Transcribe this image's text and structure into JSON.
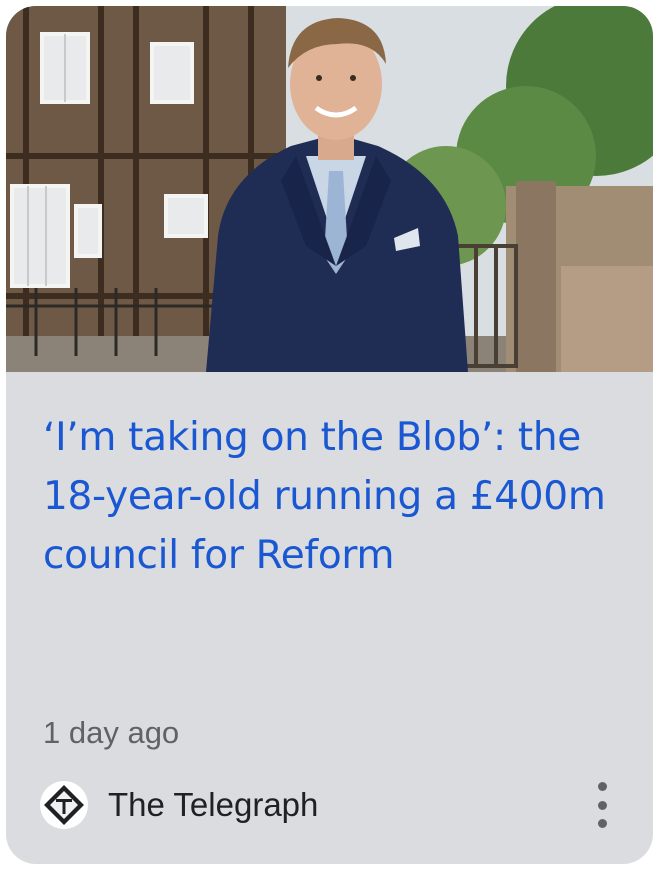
{
  "article": {
    "headline": "‘I’m taking on the Blob’: the 18-year-old running a £400m council for Reform",
    "timestamp": "1 day ago",
    "source": {
      "name": "The Telegraph",
      "logo_icon": "telegraph-logo-icon"
    },
    "image": {
      "subject": "photo-young-man-navy-suit"
    }
  },
  "menu": {
    "icon": "more-vert-icon"
  },
  "colors": {
    "headline": "#1a57d2",
    "card_background": "#dadcdf",
    "secondary_text": "#5f6368"
  }
}
